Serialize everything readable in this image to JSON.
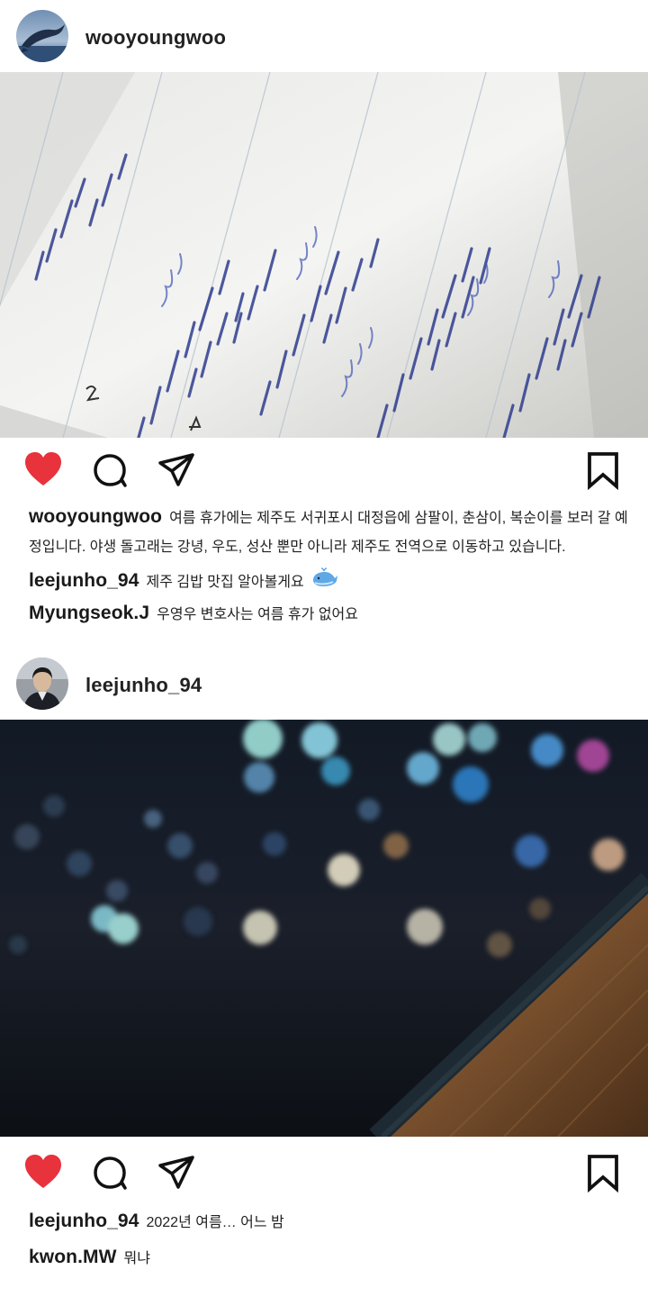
{
  "post1": {
    "username": "wooyoungwoo",
    "avatar_icon": "whale-avatar",
    "image_icon": "handwritten-notebook-photo",
    "caption_username": "wooyoungwoo",
    "caption_text": "여름 휴가에는 제주도 서귀포시 대정읍에 삼팔이, 춘삼이, 복순이를 보러 갈 예정입니다. 야생 돌고래는 강녕, 우도, 성산 뿐만 아니라 제주도 전역으로 이동하고 있습니다.",
    "comments": [
      {
        "username": "leejunho_94",
        "text": "제주 김밥 맛집 알아볼게요",
        "emoji_icon": "whale-emoji-icon"
      },
      {
        "username": "Myungseok.J",
        "text": "우영우 변호사는 여름 휴가 없어요"
      }
    ]
  },
  "post2": {
    "username": "leejunho_94",
    "avatar_icon": "man-portrait-avatar",
    "image_icon": "night-city-bokeh-photo",
    "comments": [
      {
        "username": "leejunho_94",
        "text": "2022년 여름… 어느 밤"
      },
      {
        "username": "kwon.MW",
        "text": "뭐냐"
      }
    ]
  },
  "colors": {
    "like": "#e8323c",
    "text": "#222222"
  }
}
